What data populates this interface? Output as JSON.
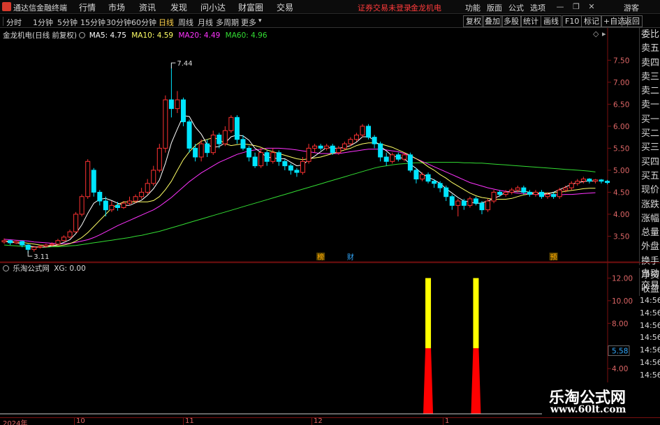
{
  "app_title": "通达信金融终端",
  "menu": [
    "行情",
    "市场",
    "资讯",
    "发现",
    "问小达",
    "财富圈",
    "交易"
  ],
  "alert_text": "证券交易未登录",
  "stock_name_red": "金龙机电",
  "right_menu": [
    "功能",
    "版面",
    "公式",
    "选项"
  ],
  "guest_label": "游客",
  "periods": [
    "分时",
    "1分钟",
    "5分钟",
    "15分钟",
    "30分钟",
    "60分钟",
    "日线",
    "周线",
    "月线",
    "多周期",
    "更多"
  ],
  "active_period": "日线",
  "toolbar_right": [
    "复权",
    "叠加",
    "多股",
    "统计",
    "画线",
    "F10",
    "标记",
    "+自选",
    "返回"
  ],
  "main": {
    "title": "金龙机电(日线 前复权)",
    "ma5": "MA5: 4.75",
    "ma10": "MA10: 4.59",
    "ma20": "MA20: 4.49",
    "ma60": "MA60: 4.96",
    "high_label": "7.44",
    "low_label": "3.11",
    "event_labels": [
      "榜",
      "财",
      "预"
    ],
    "price_ticks": [
      "7.50",
      "7.00",
      "6.50",
      "6.00",
      "5.50",
      "5.00",
      "4.50",
      "4.00",
      "3.50"
    ]
  },
  "colors": {
    "up": "#ff3232",
    "down": "#00e5ff",
    "ma5": "#ffffff",
    "ma10": "#ffff66",
    "ma20": "#ff33ff",
    "ma60": "#33dd33",
    "signal_top": "#ffff00",
    "signal_bottom": "#ff0000"
  },
  "quote_panel": [
    "委比",
    "卖五",
    "卖四",
    "卖三",
    "卖二",
    "卖一",
    "买一",
    "买二",
    "买三",
    "买四",
    "买五",
    "现价",
    "涨跌",
    "涨幅",
    "总量",
    "外盘",
    "换手",
    "净资",
    "收益"
  ],
  "sub": {
    "title": "乐淘公式网",
    "xg": "XG: 0.00",
    "ticks": [
      "12.00",
      "10.00",
      "8.00",
      "5.58",
      "4.00"
    ],
    "marker": "5.58",
    "panel": [
      "自动",
      "交易"
    ],
    "times": [
      "14:56",
      "14:56",
      "14:56",
      "14:56",
      "14:56",
      "14:56",
      "14:56",
      "14:56"
    ]
  },
  "time_axis": [
    "2024年",
    "10",
    "11",
    "12",
    "1"
  ],
  "watermark": {
    "line1": "乐淘公式网",
    "line2": "www.60lt.com"
  },
  "chart_data": {
    "type": "candlestick",
    "ylim": [
      3.0,
      7.6
    ],
    "candles": [
      {
        "o": 3.37,
        "c": 3.4,
        "h": 3.45,
        "l": 3.33
      },
      {
        "o": 3.4,
        "c": 3.35,
        "h": 3.42,
        "l": 3.3
      },
      {
        "o": 3.35,
        "c": 3.38,
        "h": 3.41,
        "l": 3.32
      },
      {
        "o": 3.38,
        "c": 3.3,
        "h": 3.4,
        "l": 3.25
      },
      {
        "o": 3.3,
        "c": 3.2,
        "h": 3.32,
        "l": 3.11
      },
      {
        "o": 3.2,
        "c": 3.25,
        "h": 3.28,
        "l": 3.15
      },
      {
        "o": 3.25,
        "c": 3.27,
        "h": 3.3,
        "l": 3.22
      },
      {
        "o": 3.27,
        "c": 3.3,
        "h": 3.33,
        "l": 3.24
      },
      {
        "o": 3.3,
        "c": 3.32,
        "h": 3.36,
        "l": 3.27
      },
      {
        "o": 3.32,
        "c": 3.4,
        "h": 3.44,
        "l": 3.3
      },
      {
        "o": 3.4,
        "c": 3.48,
        "h": 3.52,
        "l": 3.38
      },
      {
        "o": 3.48,
        "c": 3.6,
        "h": 3.65,
        "l": 3.45
      },
      {
        "o": 3.6,
        "c": 4.0,
        "h": 4.05,
        "l": 3.58
      },
      {
        "o": 4.0,
        "c": 4.4,
        "h": 4.45,
        "l": 3.95
      },
      {
        "o": 4.4,
        "c": 5.2,
        "h": 5.25,
        "l": 4.35
      },
      {
        "o": 5.0,
        "c": 4.5,
        "h": 5.05,
        "l": 4.4
      },
      {
        "o": 4.5,
        "c": 4.3,
        "h": 4.55,
        "l": 4.2
      },
      {
        "o": 4.3,
        "c": 4.1,
        "h": 4.4,
        "l": 3.95
      },
      {
        "o": 4.1,
        "c": 4.2,
        "h": 4.3,
        "l": 4.05
      },
      {
        "o": 4.2,
        "c": 4.15,
        "h": 4.28,
        "l": 4.08
      },
      {
        "o": 4.15,
        "c": 4.25,
        "h": 4.3,
        "l": 4.12
      },
      {
        "o": 4.25,
        "c": 4.3,
        "h": 4.4,
        "l": 4.2
      },
      {
        "o": 4.3,
        "c": 4.4,
        "h": 4.45,
        "l": 4.25
      },
      {
        "o": 4.4,
        "c": 4.5,
        "h": 4.6,
        "l": 4.35
      },
      {
        "o": 4.5,
        "c": 4.7,
        "h": 4.8,
        "l": 4.45
      },
      {
        "o": 4.7,
        "c": 5.0,
        "h": 5.1,
        "l": 4.65
      },
      {
        "o": 5.0,
        "c": 5.5,
        "h": 5.6,
        "l": 4.95
      },
      {
        "o": 5.5,
        "c": 6.6,
        "h": 6.7,
        "l": 5.4
      },
      {
        "o": 6.6,
        "c": 6.4,
        "h": 7.44,
        "l": 6.2
      },
      {
        "o": 6.4,
        "c": 6.6,
        "h": 6.8,
        "l": 6.3
      },
      {
        "o": 6.6,
        "c": 6.1,
        "h": 6.65,
        "l": 6.0
      },
      {
        "o": 6.1,
        "c": 5.5,
        "h": 6.15,
        "l": 5.4
      },
      {
        "o": 5.5,
        "c": 5.3,
        "h": 5.6,
        "l": 5.2
      },
      {
        "o": 5.3,
        "c": 5.6,
        "h": 5.7,
        "l": 5.2
      },
      {
        "o": 5.6,
        "c": 5.4,
        "h": 5.7,
        "l": 5.3
      },
      {
        "o": 5.4,
        "c": 5.8,
        "h": 5.9,
        "l": 5.35
      },
      {
        "o": 5.8,
        "c": 5.6,
        "h": 5.85,
        "l": 5.5
      },
      {
        "o": 5.6,
        "c": 5.9,
        "h": 6.0,
        "l": 5.55
      },
      {
        "o": 5.9,
        "c": 6.2,
        "h": 6.25,
        "l": 5.85
      },
      {
        "o": 6.2,
        "c": 5.7,
        "h": 6.25,
        "l": 5.6
      },
      {
        "o": 5.7,
        "c": 5.5,
        "h": 5.8,
        "l": 5.45
      },
      {
        "o": 5.5,
        "c": 5.3,
        "h": 5.55,
        "l": 5.2
      },
      {
        "o": 5.3,
        "c": 5.1,
        "h": 5.4,
        "l": 5.05
      },
      {
        "o": 5.1,
        "c": 5.4,
        "h": 5.5,
        "l": 5.05
      },
      {
        "o": 5.4,
        "c": 5.2,
        "h": 5.45,
        "l": 5.1
      },
      {
        "o": 5.2,
        "c": 5.4,
        "h": 5.5,
        "l": 5.15
      },
      {
        "o": 5.4,
        "c": 5.2,
        "h": 5.45,
        "l": 5.1
      },
      {
        "o": 5.2,
        "c": 5.1,
        "h": 5.25,
        "l": 5.0
      },
      {
        "o": 5.1,
        "c": 5.0,
        "h": 5.15,
        "l": 4.9
      },
      {
        "o": 5.0,
        "c": 4.95,
        "h": 5.05,
        "l": 4.85
      },
      {
        "o": 4.95,
        "c": 5.2,
        "h": 5.3,
        "l": 4.9
      },
      {
        "o": 5.2,
        "c": 5.5,
        "h": 5.6,
        "l": 5.15
      },
      {
        "o": 5.5,
        "c": 5.55,
        "h": 5.6,
        "l": 5.4
      },
      {
        "o": 5.55,
        "c": 5.5,
        "h": 5.6,
        "l": 5.45
      },
      {
        "o": 5.5,
        "c": 5.55,
        "h": 5.6,
        "l": 5.45
      },
      {
        "o": 5.55,
        "c": 5.4,
        "h": 5.6,
        "l": 5.35
      },
      {
        "o": 5.4,
        "c": 5.5,
        "h": 5.55,
        "l": 5.35
      },
      {
        "o": 5.5,
        "c": 5.6,
        "h": 5.65,
        "l": 5.45
      },
      {
        "o": 5.6,
        "c": 5.7,
        "h": 5.75,
        "l": 5.55
      },
      {
        "o": 5.7,
        "c": 5.8,
        "h": 5.85,
        "l": 5.65
      },
      {
        "o": 5.8,
        "c": 6.0,
        "h": 6.05,
        "l": 5.75
      },
      {
        "o": 6.0,
        "c": 5.75,
        "h": 6.05,
        "l": 5.7
      },
      {
        "o": 5.75,
        "c": 5.6,
        "h": 5.8,
        "l": 5.5
      },
      {
        "o": 5.6,
        "c": 5.3,
        "h": 5.65,
        "l": 5.2
      },
      {
        "o": 5.3,
        "c": 5.2,
        "h": 5.4,
        "l": 5.1
      },
      {
        "o": 5.2,
        "c": 5.35,
        "h": 5.4,
        "l": 5.15
      },
      {
        "o": 5.35,
        "c": 5.25,
        "h": 5.4,
        "l": 5.2
      },
      {
        "o": 5.25,
        "c": 5.35,
        "h": 5.4,
        "l": 5.2
      },
      {
        "o": 5.35,
        "c": 5.0,
        "h": 5.4,
        "l": 4.95
      },
      {
        "o": 5.0,
        "c": 4.8,
        "h": 5.05,
        "l": 4.7
      },
      {
        "o": 4.8,
        "c": 4.9,
        "h": 4.95,
        "l": 4.75
      },
      {
        "o": 4.9,
        "c": 4.75,
        "h": 4.95,
        "l": 4.7
      },
      {
        "o": 4.75,
        "c": 4.7,
        "h": 4.8,
        "l": 4.6
      },
      {
        "o": 4.7,
        "c": 4.6,
        "h": 4.75,
        "l": 4.5
      },
      {
        "o": 4.6,
        "c": 4.4,
        "h": 4.65,
        "l": 4.3
      },
      {
        "o": 4.4,
        "c": 4.2,
        "h": 4.45,
        "l": 4.1
      },
      {
        "o": 4.2,
        "c": 4.3,
        "h": 4.35,
        "l": 3.95
      },
      {
        "o": 4.3,
        "c": 4.2,
        "h": 4.35,
        "l": 4.1
      },
      {
        "o": 4.2,
        "c": 4.35,
        "h": 4.4,
        "l": 4.15
      },
      {
        "o": 4.35,
        "c": 4.25,
        "h": 4.4,
        "l": 4.2
      },
      {
        "o": 4.25,
        "c": 4.1,
        "h": 4.3,
        "l": 4.0
      },
      {
        "o": 4.1,
        "c": 4.3,
        "h": 4.35,
        "l": 4.05
      },
      {
        "o": 4.3,
        "c": 4.5,
        "h": 4.55,
        "l": 4.25
      },
      {
        "o": 4.5,
        "c": 4.45,
        "h": 4.55,
        "l": 4.4
      },
      {
        "o": 4.45,
        "c": 4.5,
        "h": 4.55,
        "l": 4.4
      },
      {
        "o": 4.5,
        "c": 4.55,
        "h": 4.6,
        "l": 4.45
      },
      {
        "o": 4.55,
        "c": 4.6,
        "h": 4.65,
        "l": 4.5
      },
      {
        "o": 4.6,
        "c": 4.5,
        "h": 4.65,
        "l": 4.45
      },
      {
        "o": 4.5,
        "c": 4.45,
        "h": 4.55,
        "l": 4.4
      },
      {
        "o": 4.45,
        "c": 4.5,
        "h": 4.55,
        "l": 4.4
      },
      {
        "o": 4.5,
        "c": 4.4,
        "h": 4.55,
        "l": 4.35
      },
      {
        "o": 4.4,
        "c": 4.45,
        "h": 4.5,
        "l": 4.35
      },
      {
        "o": 4.45,
        "c": 4.4,
        "h": 4.5,
        "l": 4.35
      },
      {
        "o": 4.4,
        "c": 4.55,
        "h": 4.6,
        "l": 4.35
      },
      {
        "o": 4.55,
        "c": 4.6,
        "h": 4.65,
        "l": 4.5
      },
      {
        "o": 4.6,
        "c": 4.7,
        "h": 4.75,
        "l": 4.55
      },
      {
        "o": 4.7,
        "c": 4.75,
        "h": 4.8,
        "l": 4.65
      },
      {
        "o": 4.75,
        "c": 4.8,
        "h": 4.85,
        "l": 4.7
      },
      {
        "o": 4.8,
        "c": 4.75,
        "h": 4.82,
        "l": 4.7
      },
      {
        "o": 4.75,
        "c": 4.78,
        "h": 4.8,
        "l": 4.7
      },
      {
        "o": 4.78,
        "c": 4.75,
        "h": 4.8,
        "l": 4.7
      },
      {
        "o": 4.75,
        "c": 4.72,
        "h": 4.78,
        "l": 4.68
      }
    ],
    "ma5": [
      3.38,
      3.37,
      3.35,
      3.32,
      3.28,
      3.26,
      3.25,
      3.26,
      3.28,
      3.31,
      3.36,
      3.42,
      3.56,
      3.76,
      4.02,
      4.25,
      4.34,
      4.36,
      4.31,
      4.25,
      4.2,
      4.2,
      4.26,
      4.32,
      4.43,
      4.58,
      4.78,
      5.16,
      5.62,
      5.94,
      6.24,
      6.22,
      5.98,
      5.82,
      5.58,
      5.52,
      5.54,
      5.62,
      5.76,
      5.8,
      5.78,
      5.68,
      5.5,
      5.4,
      5.3,
      5.28,
      5.26,
      5.26,
      5.18,
      5.1,
      5.12,
      5.24,
      5.32,
      5.42,
      5.52,
      5.5,
      5.5,
      5.52,
      5.56,
      5.64,
      5.76,
      5.76,
      5.68,
      5.54,
      5.44,
      5.32,
      5.3,
      5.26,
      5.14,
      5.04,
      4.92,
      4.84,
      4.78,
      4.7,
      4.58,
      4.48,
      4.38,
      4.3,
      4.28,
      4.24,
      4.26,
      4.3,
      4.36,
      4.42,
      4.5,
      4.52,
      4.52,
      4.52,
      4.5,
      4.48,
      4.46,
      4.46,
      4.5,
      4.56,
      4.62,
      4.68,
      4.72,
      4.74,
      4.76,
      4.75
    ],
    "ma10": [
      3.39,
      3.38,
      3.37,
      3.36,
      3.34,
      3.32,
      3.3,
      3.29,
      3.28,
      3.28,
      3.3,
      3.33,
      3.39,
      3.47,
      3.58,
      3.72,
      3.86,
      4.0,
      4.14,
      4.22,
      4.28,
      4.28,
      4.28,
      4.28,
      4.28,
      4.31,
      4.4,
      4.56,
      4.75,
      5.0,
      5.24,
      5.42,
      5.56,
      5.66,
      5.7,
      5.74,
      5.7,
      5.6,
      5.56,
      5.58,
      5.6,
      5.58,
      5.56,
      5.52,
      5.46,
      5.42,
      5.38,
      5.34,
      5.3,
      5.26,
      5.24,
      5.26,
      5.28,
      5.3,
      5.34,
      5.38,
      5.42,
      5.46,
      5.5,
      5.56,
      5.6,
      5.62,
      5.62,
      5.6,
      5.56,
      5.52,
      5.46,
      5.4,
      5.34,
      5.26,
      5.18,
      5.08,
      5.0,
      4.9,
      4.82,
      4.72,
      4.64,
      4.56,
      4.48,
      4.42,
      4.38,
      4.36,
      4.34,
      4.34,
      4.34,
      4.36,
      4.4,
      4.44,
      4.46,
      4.48,
      4.48,
      4.48,
      4.49,
      4.5,
      4.52,
      4.54,
      4.56,
      4.58,
      4.59,
      4.59
    ],
    "ma20": [
      3.43,
      3.42,
      3.41,
      3.4,
      3.39,
      3.37,
      3.36,
      3.35,
      3.34,
      3.33,
      3.33,
      3.34,
      3.36,
      3.39,
      3.42,
      3.47,
      3.53,
      3.6,
      3.67,
      3.74,
      3.8,
      3.86,
      3.92,
      3.98,
      4.04,
      4.1,
      4.18,
      4.28,
      4.38,
      4.5,
      4.62,
      4.74,
      4.84,
      4.94,
      5.02,
      5.1,
      5.18,
      5.24,
      5.3,
      5.36,
      5.4,
      5.44,
      5.46,
      5.48,
      5.5,
      5.5,
      5.5,
      5.49,
      5.48,
      5.46,
      5.44,
      5.42,
      5.4,
      5.38,
      5.38,
      5.38,
      5.38,
      5.4,
      5.42,
      5.44,
      5.46,
      5.48,
      5.48,
      5.48,
      5.46,
      5.44,
      5.42,
      5.38,
      5.32,
      5.26,
      5.2,
      5.14,
      5.08,
      5.02,
      4.96,
      4.9,
      4.84,
      4.78,
      4.72,
      4.68,
      4.64,
      4.6,
      4.57,
      4.54,
      4.52,
      4.5,
      4.48,
      4.47,
      4.46,
      4.45,
      4.44,
      4.44,
      4.44,
      4.44,
      4.45,
      4.45,
      4.46,
      4.47,
      4.48,
      4.49
    ],
    "ma60": [
      3.3,
      3.29,
      3.28,
      3.27,
      3.26,
      3.25,
      3.25,
      3.25,
      3.26,
      3.26,
      3.27,
      3.28,
      3.29,
      3.31,
      3.33,
      3.35,
      3.37,
      3.39,
      3.41,
      3.43,
      3.45,
      3.47,
      3.5,
      3.52,
      3.55,
      3.58,
      3.61,
      3.65,
      3.69,
      3.73,
      3.77,
      3.81,
      3.85,
      3.89,
      3.93,
      3.97,
      4.01,
      4.05,
      4.09,
      4.13,
      4.17,
      4.21,
      4.25,
      4.29,
      4.33,
      4.37,
      4.41,
      4.45,
      4.49,
      4.53,
      4.57,
      4.61,
      4.65,
      4.69,
      4.73,
      4.77,
      4.81,
      4.85,
      4.89,
      4.93,
      4.97,
      5.01,
      5.05,
      5.08,
      5.1,
      5.12,
      5.14,
      5.15,
      5.16,
      5.17,
      5.17,
      5.18,
      5.18,
      5.18,
      5.18,
      5.18,
      5.18,
      5.17,
      5.17,
      5.16,
      5.16,
      5.15,
      5.14,
      5.13,
      5.12,
      5.11,
      5.1,
      5.09,
      5.08,
      5.07,
      5.06,
      5.05,
      5.04,
      5.03,
      5.02,
      5.01,
      5.0,
      4.99,
      4.98,
      4.96
    ],
    "event_candles": [
      53,
      58,
      92
    ],
    "signal": {
      "ylim": [
        0,
        13.2
      ],
      "peaks": [
        {
          "index": 71,
          "value": 12.0,
          "split": 5.8
        },
        {
          "index": 79,
          "value": 12.0,
          "split": 5.8
        }
      ]
    }
  }
}
